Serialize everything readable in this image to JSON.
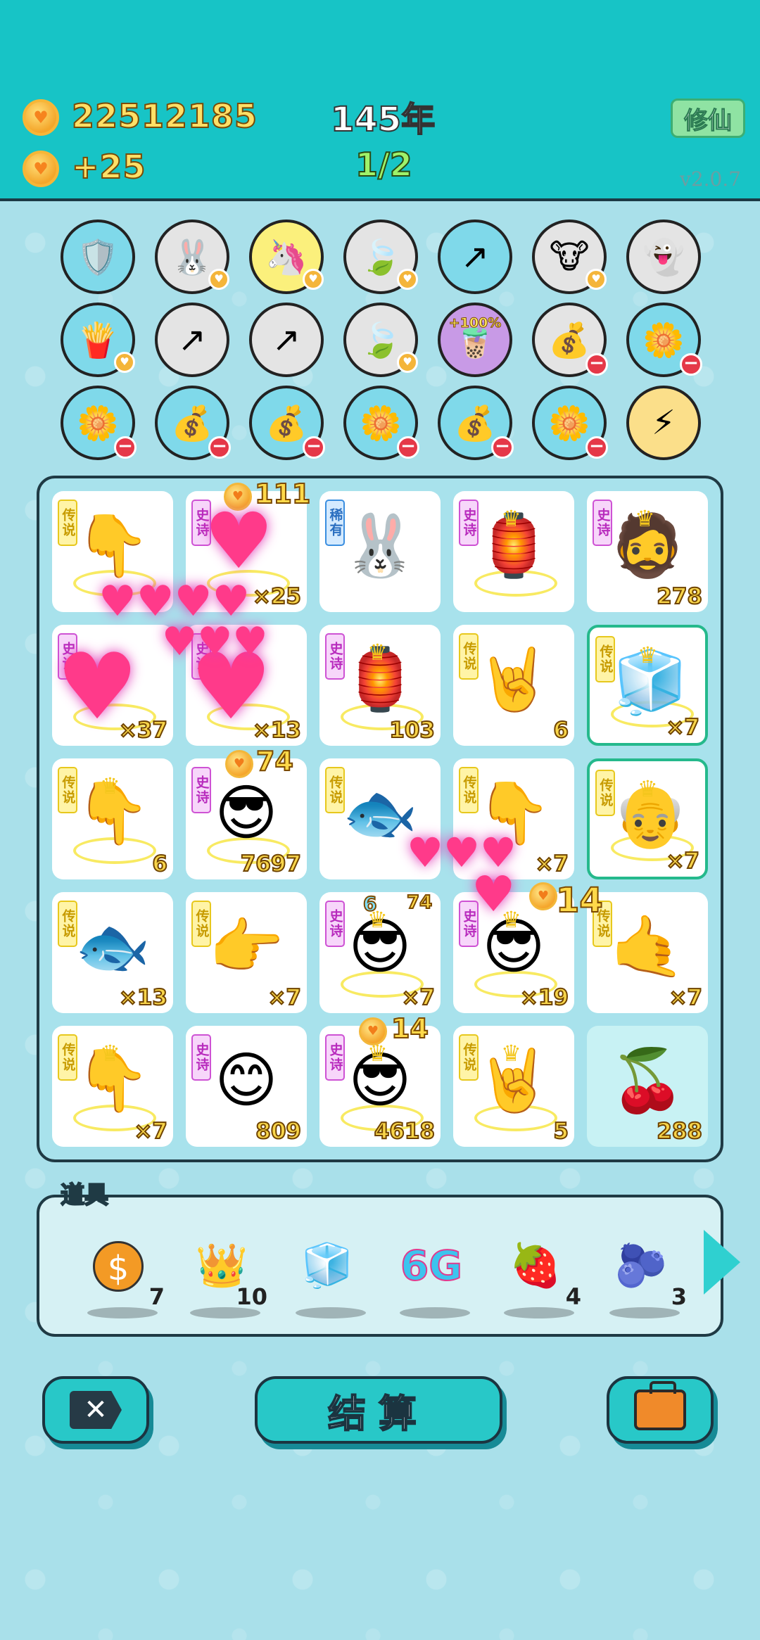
{
  "header": {
    "coins_total": "22512185",
    "coins_rate": "+25",
    "year": "145年",
    "progress": "1/2",
    "cultivate_label": "修仙",
    "version": "v2.0.7"
  },
  "buffs": [
    {
      "icon": "wrench-shield-icon",
      "glyph": "🛡️",
      "bg": "#7fd9ea",
      "badge": ""
    },
    {
      "icon": "rabbit-icon",
      "glyph": "🐰",
      "bg": "#e4e4e4",
      "badge": "heart"
    },
    {
      "icon": "unicorn-icon",
      "glyph": "🦄",
      "bg": "#fbf07c",
      "badge": "heart"
    },
    {
      "icon": "leaf-icon",
      "glyph": "🍃",
      "bg": "#e4e4e4",
      "badge": "heart"
    },
    {
      "icon": "arrow-up-right-icon",
      "glyph": "↗",
      "bg": "#7fd9ea",
      "badge": ""
    },
    {
      "icon": "cow-couple-icon",
      "glyph": "🐮",
      "bg": "#e4e4e4",
      "badge": "heart"
    },
    {
      "icon": "ghost-icon",
      "glyph": "👻",
      "bg": "#e4e4e4",
      "badge": ""
    },
    {
      "icon": "fries-icon",
      "glyph": "🍟",
      "bg": "#7fd9ea",
      "badge": "heart"
    },
    {
      "icon": "arrow-up-right-icon",
      "glyph": "↗",
      "bg": "#e4e4e4",
      "badge": ""
    },
    {
      "icon": "arrow-up-right-icon",
      "glyph": "↗",
      "bg": "#e4e4e4",
      "badge": ""
    },
    {
      "icon": "leaf-icon",
      "glyph": "🍃",
      "bg": "#e4e4e4",
      "badge": "heart"
    },
    {
      "icon": "milk-tea-icon",
      "glyph": "🧋",
      "bg": "#c89ae6",
      "badge": "",
      "text": "+100%"
    },
    {
      "icon": "money-bag-icon",
      "glyph": "💰",
      "bg": "#e4e4e4",
      "badge": "minus"
    },
    {
      "icon": "potted-flower-icon",
      "glyph": "🌼",
      "bg": "#7fd9ea",
      "badge": "minus"
    },
    {
      "icon": "potted-flower-icon",
      "glyph": "🌼",
      "bg": "#7fd9ea",
      "badge": "minus"
    },
    {
      "icon": "money-bag-icon",
      "glyph": "💰",
      "bg": "#7fd9ea",
      "badge": "minus"
    },
    {
      "icon": "money-bag-icon",
      "glyph": "💰",
      "bg": "#7fd9ea",
      "badge": "minus"
    },
    {
      "icon": "potted-flower-icon",
      "glyph": "🌼",
      "bg": "#7fd9ea",
      "badge": "minus"
    },
    {
      "icon": "money-bag-icon",
      "glyph": "💰",
      "bg": "#7fd9ea",
      "badge": "minus"
    },
    {
      "icon": "potted-flower-icon",
      "glyph": "🌼",
      "bg": "#7fd9ea",
      "badge": "minus"
    },
    {
      "icon": "lightning-icon",
      "glyph": "⚡",
      "bg": "#fbdf8a",
      "badge": ""
    }
  ],
  "board": [
    {
      "tag": "传说",
      "tier": "legend",
      "icon": "pointing-hand-icon",
      "glyph": "👇",
      "count": "",
      "ring": true,
      "crown": false
    },
    {
      "tag": "史诗",
      "tier": "epic",
      "icon": "heart-effect-icon",
      "glyph": "",
      "count": "×25",
      "ring": true,
      "crown": false
    },
    {
      "tag": "稀有",
      "tier": "rare",
      "icon": "rabbit-icon",
      "glyph": "🐰",
      "count": "",
      "ring": false,
      "crown": false
    },
    {
      "tag": "史诗",
      "tier": "epic",
      "icon": "rabbit-house-icon",
      "glyph": "🏮",
      "count": "",
      "ring": true,
      "crown": true
    },
    {
      "tag": "史诗",
      "tier": "epic",
      "icon": "bearded-man-icon",
      "glyph": "🧔",
      "count": "278",
      "ring": false,
      "crown": true
    },
    {
      "tag": "史诗",
      "tier": "epic",
      "icon": "heart-effect-icon",
      "glyph": "",
      "count": "×37",
      "ring": true,
      "crown": false
    },
    {
      "tag": "史诗",
      "tier": "epic",
      "icon": "heart-effect-icon",
      "glyph": "",
      "count": "×13",
      "ring": true,
      "crown": false
    },
    {
      "tag": "史诗",
      "tier": "epic",
      "icon": "rabbit-house-icon",
      "glyph": "🏮",
      "count": "103",
      "ring": true,
      "crown": true
    },
    {
      "tag": "传说",
      "tier": "legend",
      "icon": "rock-hand-icon",
      "glyph": "🤘",
      "count": "6",
      "ring": false,
      "crown": false
    },
    {
      "tag": "传说",
      "tier": "legend",
      "icon": "fridge-icon",
      "glyph": "🧊",
      "count": "×7",
      "ring": true,
      "crown": true,
      "selected": true
    },
    {
      "tag": "传说",
      "tier": "legend",
      "icon": "pointing-hand-icon",
      "glyph": "👇",
      "count": "6",
      "ring": true,
      "crown": true
    },
    {
      "tag": "史诗",
      "tier": "epic",
      "icon": "sunglasses-man-icon",
      "glyph": "😎",
      "count": "7697",
      "ring": true,
      "crown": false
    },
    {
      "tag": "传说",
      "tier": "legend",
      "icon": "koi-fish-icon",
      "glyph": "🐟",
      "count": "",
      "ring": false,
      "crown": false
    },
    {
      "tag": "传说",
      "tier": "legend",
      "icon": "pointing-hand-icon",
      "glyph": "👇",
      "count": "×7",
      "ring": false,
      "crown": false
    },
    {
      "tag": "传说",
      "tier": "legend",
      "icon": "grandpa-icon",
      "glyph": "👴",
      "count": "×7",
      "ring": true,
      "crown": true,
      "selected": true
    },
    {
      "tag": "传说",
      "tier": "legend",
      "icon": "koi-fish-icon",
      "glyph": "🐟",
      "count": "×13",
      "ring": false,
      "crown": false
    },
    {
      "tag": "传说",
      "tier": "legend",
      "icon": "pointing-hand-icon",
      "glyph": "👉",
      "count": "×7",
      "ring": false,
      "crown": false
    },
    {
      "tag": "史诗",
      "tier": "epic",
      "icon": "sunglasses-man-icon",
      "glyph": "😎",
      "count": "×7",
      "ring": true,
      "crown": true
    },
    {
      "tag": "史诗",
      "tier": "epic",
      "icon": "sunglasses-man-icon",
      "glyph": "😎",
      "count": "×19",
      "ring": true,
      "crown": true
    },
    {
      "tag": "传说",
      "tier": "legend",
      "icon": "rock-hand-icon",
      "glyph": "🤙",
      "count": "×7",
      "ring": false,
      "crown": false
    },
    {
      "tag": "传说",
      "tier": "legend",
      "icon": "pointing-hand-icon",
      "glyph": "👇",
      "count": "×7",
      "ring": true,
      "crown": true
    },
    {
      "tag": "史诗",
      "tier": "epic",
      "icon": "smiley-face-icon",
      "glyph": "😊",
      "count": "809",
      "ring": false,
      "crown": false
    },
    {
      "tag": "史诗",
      "tier": "epic",
      "icon": "sunglasses-man-icon",
      "glyph": "😎",
      "count": "4618",
      "ring": true,
      "crown": true
    },
    {
      "tag": "传说",
      "tier": "legend",
      "icon": "rock-hand-icon",
      "glyph": "🤘",
      "count": "5",
      "ring": true,
      "crown": true
    },
    {
      "tag": "",
      "tier": "plain",
      "icon": "cherries-icon",
      "glyph": "🍒",
      "count": "288",
      "ring": false,
      "crown": false
    }
  ],
  "floating": {
    "a": "111",
    "b": "74",
    "c": "14",
    "d": "14",
    "e": "6",
    "f": "74"
  },
  "items": {
    "label": "道具",
    "list": [
      {
        "icon": "dollar-coin-icon",
        "glyph": "$",
        "qty": "7"
      },
      {
        "icon": "crown-icon",
        "glyph": "👑",
        "qty": "10"
      },
      {
        "icon": "fridge-frame-icon",
        "glyph": "🧊",
        "qty": ""
      },
      {
        "icon": "6g-icon",
        "glyph": "6G",
        "qty": ""
      },
      {
        "icon": "bayberry-icon",
        "glyph": "🍓",
        "qty": "4"
      },
      {
        "icon": "blueberry-icon",
        "glyph": "🫐",
        "qty": "3"
      }
    ]
  },
  "buttons": {
    "settle_label": "结算"
  }
}
